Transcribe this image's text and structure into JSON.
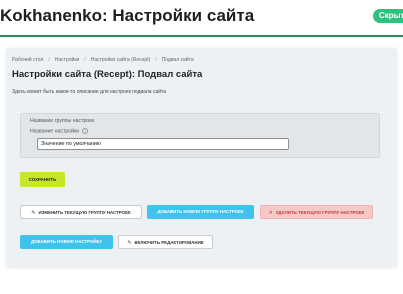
{
  "header": {
    "title": "Kokhanenko: Настройки сайта",
    "hide_button": "Скрыть"
  },
  "breadcrumb": {
    "items": [
      "Рабочий стол",
      "Настройки",
      "Настройки сайта (Recept)",
      "Подвал сайта"
    ]
  },
  "page": {
    "title": "Настройки сайта (Recept): Подвал сайта",
    "description": "Здесь может быть какое-то описание для настроек подвала сайта"
  },
  "group": {
    "group_label": "Название группы настроек",
    "setting_label": "Название настройки",
    "input_value": "Значение по умолчанию"
  },
  "buttons": {
    "save": "СОХРАНИТЬ",
    "edit_group": "ИЗМЕНИТЬ ТЕКУЩУЮ ГРУППУ НАСТРОЕК",
    "add_group": "ДОБАВИТЬ НОВУЮ ГРУППУ НАСТРОЕК",
    "delete_group": "УДАЛИТЬ ТЕКУЩУЮ ГРУППУ НАСТРОЕК",
    "add_setting": "ДОБАВИТЬ НОВУЮ НАСТРОЙКУ",
    "enable_edit": "ВКЛЮЧИТЬ РЕДАКТИРОВАНИЕ"
  },
  "colors": {
    "accent_green": "#2b8a5a",
    "save": "#c7e62a",
    "primary_blue": "#3fc3ec",
    "danger": "#f6c8c8"
  },
  "icons": [
    "star-icon",
    "help-icon",
    "pencil-icon",
    "close-icon"
  ]
}
